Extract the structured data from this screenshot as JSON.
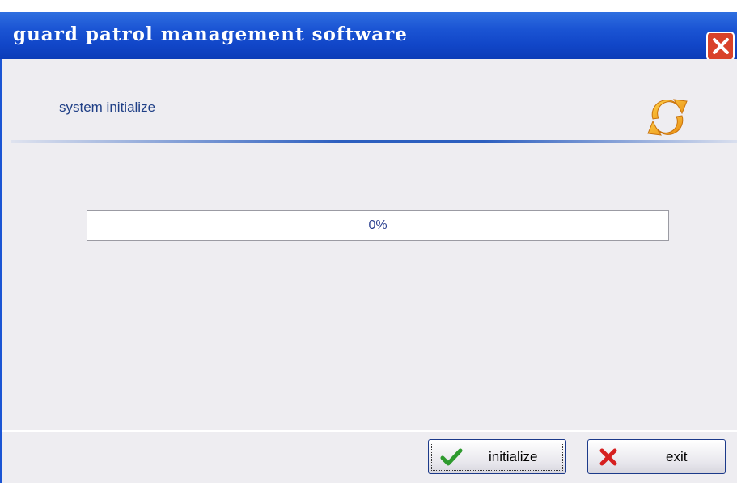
{
  "window": {
    "title": "guard patrol management software",
    "close_icon": "close-x-icon"
  },
  "header": {
    "label": "system initialize",
    "icon": "sync-icon"
  },
  "progress": {
    "value": 0,
    "text": "0%"
  },
  "buttons": {
    "initialize": {
      "label": "initialize",
      "icon": "check-icon"
    },
    "exit": {
      "label": "exit",
      "icon": "x-icon"
    }
  },
  "colors": {
    "titlebar": "#1b55d4",
    "close": "#d9422a",
    "header_text": "#1f3f86",
    "check": "#2e9a2e",
    "cross": "#d62020"
  }
}
